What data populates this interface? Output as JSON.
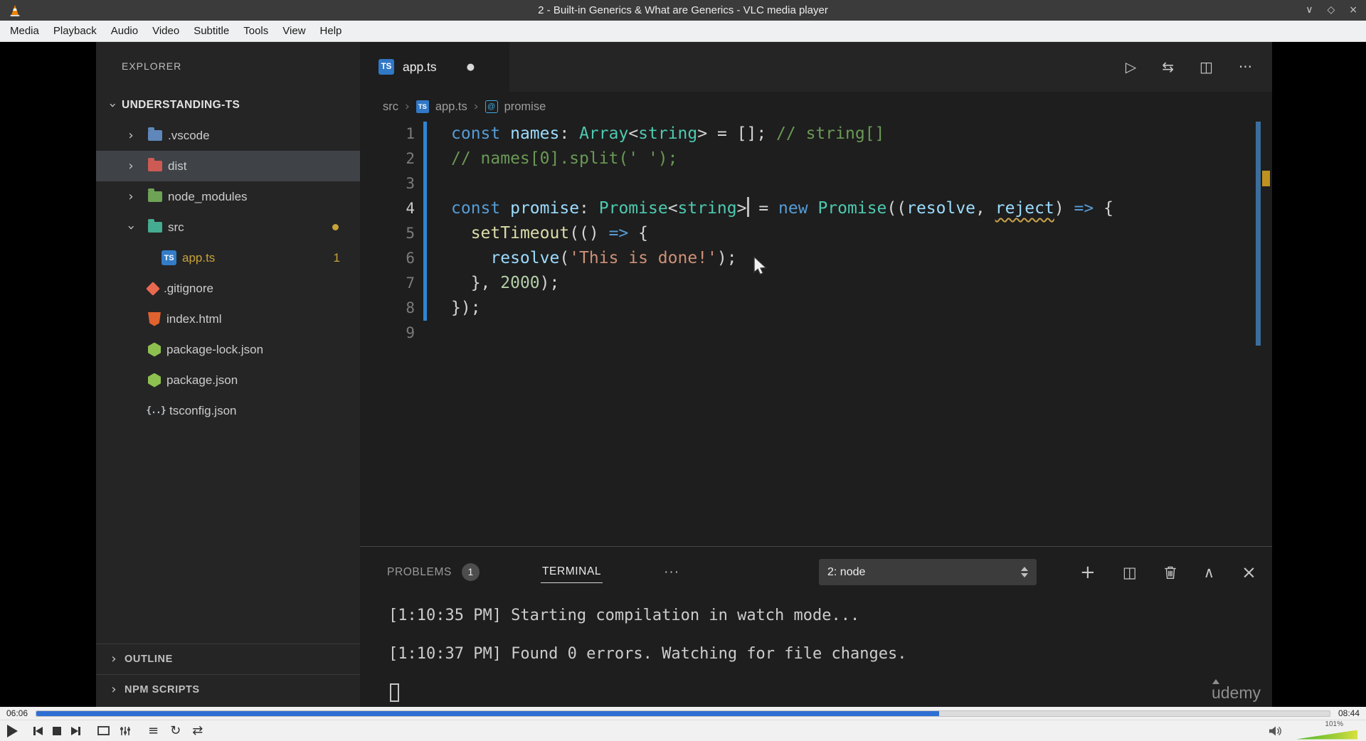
{
  "icons": {
    "ts_badge": "TS",
    "dot": "●",
    "chevron": "›",
    "ellipsis": "···",
    "plus": "+",
    "split": "◫",
    "chevron_up": "∧",
    "close": "×",
    "playlist": "≡",
    "loop": "↻",
    "shuffle": "⇄"
  },
  "vlc": {
    "window_title": "2 - Built-in Generics & What are Generics - VLC media player",
    "menu_items": [
      "Media",
      "Playback",
      "Audio",
      "Video",
      "Subtitle",
      "Tools",
      "View",
      "Help"
    ],
    "window_controls": [
      {
        "name": "minimize-icon",
        "glyph": "∨"
      },
      {
        "name": "maximize-icon",
        "glyph": "◇"
      },
      {
        "name": "close-icon",
        "glyph": "×"
      }
    ],
    "seek": {
      "elapsed": "06:06",
      "total": "08:44",
      "progress_percent": 69.8
    },
    "volume_label": "101%"
  },
  "vscode": {
    "explorer": {
      "header": "EXPLORER",
      "root_label": "UNDERSTANDING-TS",
      "items": [
        {
          "label": ".vscode",
          "icon": "folder-vscode",
          "chevron": "collapsed",
          "indent": 0,
          "row_class": ""
        },
        {
          "label": "dist",
          "icon": "folder-dist",
          "chevron": "collapsed",
          "indent": 0,
          "row_class": "highlight"
        },
        {
          "label": "node_modules",
          "icon": "folder-node",
          "chevron": "collapsed",
          "indent": 0,
          "row_class": ""
        },
        {
          "label": "src",
          "icon": "folder-src",
          "chevron": "expanded",
          "indent": 0,
          "row_class": "",
          "dot": true
        },
        {
          "label": "app.ts",
          "icon": "file-ts",
          "chevron": "none",
          "indent": 1,
          "row_class": "",
          "badge": "1",
          "label_class": "warn"
        },
        {
          "label": ".gitignore",
          "icon": "file-git",
          "chevron": "none",
          "indent": 0,
          "row_class": ""
        },
        {
          "label": "index.html",
          "icon": "file-html",
          "chevron": "none",
          "indent": 0,
          "row_class": ""
        },
        {
          "label": "package-lock.json",
          "icon": "file-node-json",
          "chevron": "none",
          "indent": 0,
          "row_class": ""
        },
        {
          "label": "package.json",
          "icon": "file-node-json",
          "chevron": "none",
          "indent": 0,
          "row_class": ""
        },
        {
          "label": "tsconfig.json",
          "icon": "file-braces",
          "chevron": "none",
          "indent": 0,
          "row_class": ""
        }
      ],
      "sections": [
        "OUTLINE",
        "NPM SCRIPTS"
      ]
    },
    "editor": {
      "tab": {
        "label": "app.ts",
        "modified": true
      },
      "actions": [
        {
          "name": "run-button",
          "glyph": "▷"
        },
        {
          "name": "open-changes-button",
          "glyph": "⇆"
        },
        {
          "name": "split-editor-button",
          "glyph": "◫"
        },
        {
          "name": "editor-more-actions-button",
          "glyph": "···"
        }
      ],
      "breadcrumb": [
        {
          "label": "src",
          "icon": "none"
        },
        {
          "label": "app.ts",
          "icon": "ts"
        },
        {
          "label": "promise",
          "icon": "symbol"
        }
      ],
      "symbol_glyph": "@",
      "code_lines": [
        {
          "num": "1",
          "changed": true,
          "tokens": [
            [
              "kw",
              "const"
            ],
            [
              "pl",
              " "
            ],
            [
              "vr",
              "names"
            ],
            [
              "pl",
              ": "
            ],
            [
              "ty",
              "Array"
            ],
            [
              "pl",
              "<"
            ],
            [
              "ty",
              "string"
            ],
            [
              "pl",
              "> = []; "
            ],
            [
              "cm",
              "// string[]"
            ]
          ]
        },
        {
          "num": "2",
          "changed": true,
          "tokens": [
            [
              "cm",
              "// names[0].split(' ');"
            ]
          ]
        },
        {
          "num": "3",
          "changed": true,
          "tokens": []
        },
        {
          "num": "4",
          "changed": true,
          "active": true,
          "tokens": [
            [
              "kw",
              "const"
            ],
            [
              "pl",
              " "
            ],
            [
              "vr",
              "promise"
            ],
            [
              "pl",
              ": "
            ],
            [
              "ty",
              "Promise"
            ],
            [
              "pl",
              "<"
            ],
            [
              "ty",
              "string"
            ],
            [
              "pl",
              ">"
            ],
            [
              "cur",
              ""
            ],
            [
              "pl",
              " = "
            ],
            [
              "kw",
              "new"
            ],
            [
              "pl",
              " "
            ],
            [
              "ty",
              "Promise"
            ],
            [
              "pl",
              "(("
            ],
            [
              "vr",
              "resolve"
            ],
            [
              "pl",
              ", "
            ],
            [
              "vr warn",
              "reject"
            ],
            [
              "pl",
              ") "
            ],
            [
              "kw",
              "=>"
            ],
            [
              "pl",
              " {"
            ]
          ]
        },
        {
          "num": "5",
          "changed": true,
          "tokens": [
            [
              "pl",
              "  "
            ],
            [
              "fn",
              "setTimeout"
            ],
            [
              "pl",
              "(() "
            ],
            [
              "kw",
              "=>"
            ],
            [
              "pl",
              " {"
            ]
          ]
        },
        {
          "num": "6",
          "changed": true,
          "tokens": [
            [
              "pl",
              "    "
            ],
            [
              "vr",
              "resolve"
            ],
            [
              "pl",
              "("
            ],
            [
              "st",
              "'This is done!'"
            ],
            [
              "pl",
              ");"
            ]
          ]
        },
        {
          "num": "7",
          "changed": true,
          "tokens": [
            [
              "pl",
              "  }, "
            ],
            [
              "nm",
              "2000"
            ],
            [
              "pl",
              ");"
            ]
          ]
        },
        {
          "num": "8",
          "changed": true,
          "tokens": [
            [
              "pl",
              "});"
            ]
          ]
        },
        {
          "num": "9",
          "changed": false,
          "tokens": []
        }
      ]
    },
    "panel": {
      "tabs": [
        {
          "label": "PROBLEMS",
          "badge": "1",
          "active": false
        },
        {
          "label": "TERMINAL",
          "active": true
        }
      ],
      "dropdown_value": "2: node",
      "terminal_lines": [
        "[1:10:35 PM] Starting compilation in watch mode...",
        "[1:10:37 PM] Found 0 errors. Watching for file changes."
      ],
      "watermark": "udemy"
    }
  }
}
